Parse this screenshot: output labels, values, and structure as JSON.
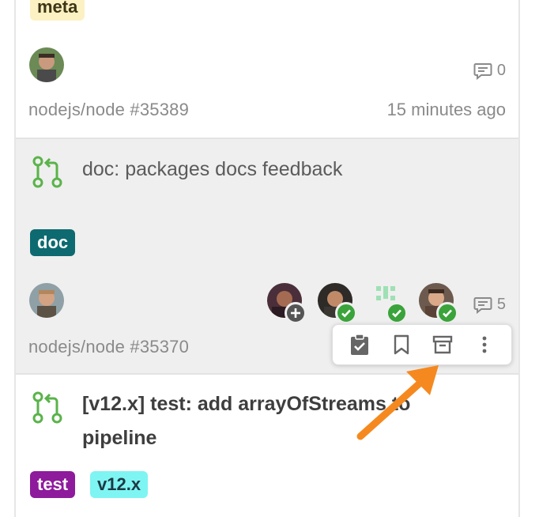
{
  "cards": [
    {
      "label": {
        "text": "meta",
        "bg": "#fbf1c2",
        "fg": "#3d3416"
      },
      "comment_count": "0",
      "repo": "nodejs/node #35389",
      "time": "15 minutes ago"
    },
    {
      "title": "doc: packages docs feedback",
      "label": {
        "text": "doc",
        "bg": "#0d6a70",
        "fg": "#ffffff"
      },
      "comment_count": "5",
      "repo": "nodejs/node #35370",
      "reviewers": [
        {
          "status": "add-reviewer-icon"
        },
        {
          "status": "approved-check-icon"
        },
        {
          "status": "approved-check-icon"
        },
        {
          "status": "approved-check-icon"
        }
      ]
    },
    {
      "title_line1": "[v12.x] test: add arrayOfStreams to",
      "title_line2": "pipeline",
      "labels": [
        {
          "text": "test",
          "bg": "#8e1a9c",
          "fg": "#ffffff"
        },
        {
          "text": "v12.x",
          "bg": "#7ef5f2",
          "fg": "#1c3a44"
        }
      ]
    }
  ],
  "toolbar": {
    "actions": [
      "mark-done-icon",
      "bookmark-icon",
      "archive-icon",
      "more-icon"
    ]
  },
  "colors": {
    "pr_icon": "#5ab34a",
    "approve_badge": "#3aa33a",
    "add_badge": "#555555",
    "annotation_arrow": "#f5891f"
  }
}
